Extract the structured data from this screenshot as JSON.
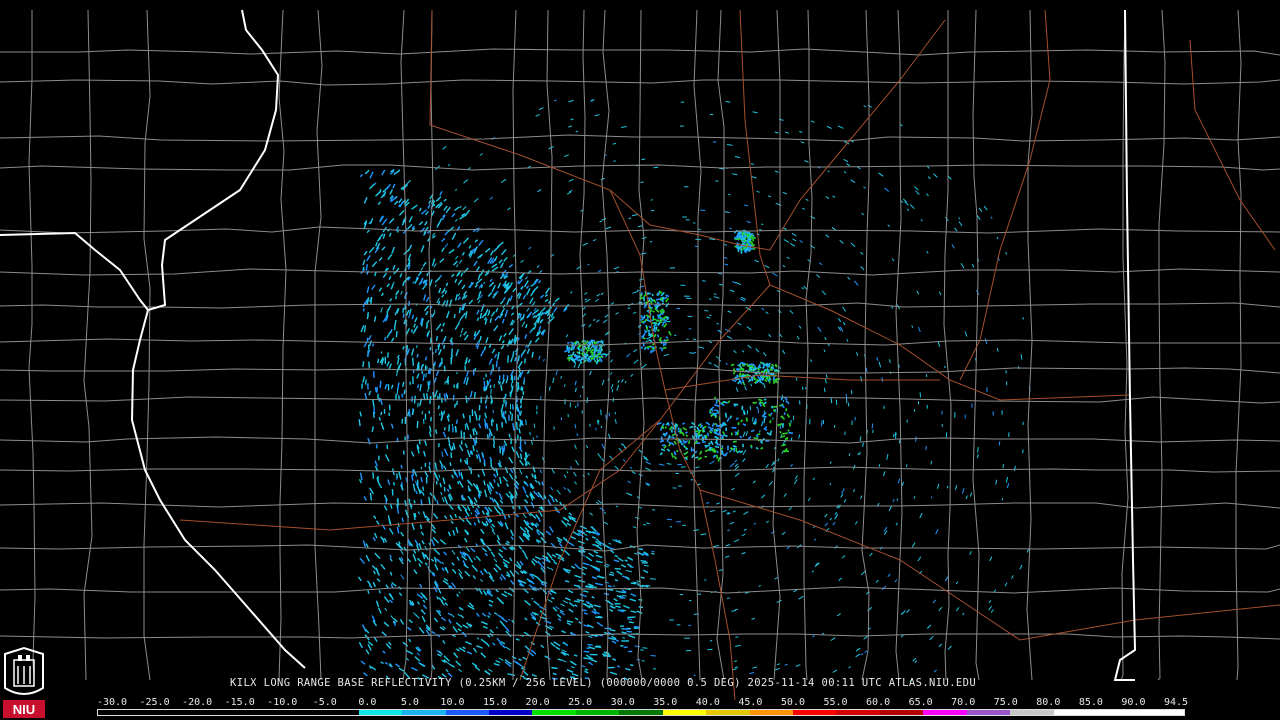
{
  "product_title": "KILX LONG RANGE BASE REFLECTIVITY (0.25KM / 256 LEVEL) (000000/0000 0.5 DEG) 2025-11-14 00:11 UTC  ATLAS.NIU.EDU",
  "logo_text": "NIU",
  "scale": {
    "labels": [
      "-30.0",
      "-25.0",
      "-20.0",
      "-15.0",
      "-10.0",
      "-5.0",
      "0.0",
      "5.0",
      "10.0",
      "15.0",
      "20.0",
      "25.0",
      "30.0",
      "35.0",
      "40.0",
      "45.0",
      "50.0",
      "55.0",
      "60.0",
      "65.0",
      "70.0",
      "75.0",
      "80.0",
      "85.0",
      "90.0",
      "94.5"
    ],
    "colors": [
      "#000000",
      "#000000",
      "#000000",
      "#000000",
      "#000000",
      "#000000",
      "#0fe6e6",
      "#1ab4f0",
      "#1a5aff",
      "#0000c8",
      "#00e000",
      "#00b400",
      "#007800",
      "#ffff00",
      "#e6c800",
      "#ff9600",
      "#ff0000",
      "#d20000",
      "#b40000",
      "#ff00ff",
      "#9a55c8",
      "#c8c8c8",
      "#ffffff",
      "#ffffff",
      "#ffffff"
    ]
  },
  "colors": {
    "background": "#000000",
    "county_lines": "#8c8c8c",
    "state_lines": "#ffffff",
    "highways": "#a5502d",
    "echo_light": "#1ec8e6",
    "echo_medium": "#1e96ff",
    "echo_heavy": "#28d228"
  }
}
